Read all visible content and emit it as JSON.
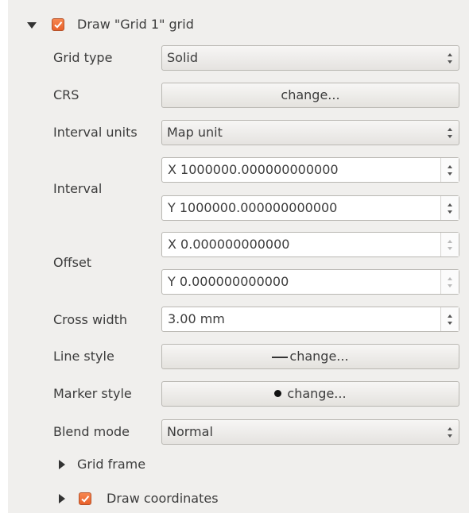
{
  "grid_group": {
    "title": "Draw \"Grid 1\" grid",
    "checked": true,
    "expanded": true
  },
  "rows": {
    "grid_type": {
      "label": "Grid type",
      "value": "Solid"
    },
    "crs": {
      "label": "CRS",
      "button": "change..."
    },
    "interval_units": {
      "label": "Interval units",
      "value": "Map unit"
    },
    "interval": {
      "label": "Interval",
      "x": "X 1000000.000000000000",
      "y": "Y 1000000.000000000000"
    },
    "offset": {
      "label": "Offset",
      "x": "X 0.000000000000",
      "y": "Y 0.000000000000"
    },
    "cross_width": {
      "label": "Cross width",
      "value": "3.00 mm"
    },
    "line_style": {
      "label": "Line style",
      "button": "change..."
    },
    "marker_style": {
      "label": "Marker style",
      "button": "change..."
    },
    "blend_mode": {
      "label": "Blend mode",
      "value": "Normal"
    }
  },
  "subgroups": {
    "grid_frame": {
      "title": "Grid frame",
      "expanded": false
    },
    "draw_coordinates": {
      "title": "Draw coordinates",
      "checked": true,
      "expanded": false
    }
  },
  "icons": {
    "expanded": "triangle-down-icon",
    "collapsed": "triangle-right-icon",
    "checkbox": "checkbox-checked-icon",
    "line_symbol": "line-symbol-icon",
    "marker_symbol": "marker-dot-icon"
  },
  "colors": {
    "checkbox": "#e9612b",
    "panel": "#f0efed"
  }
}
